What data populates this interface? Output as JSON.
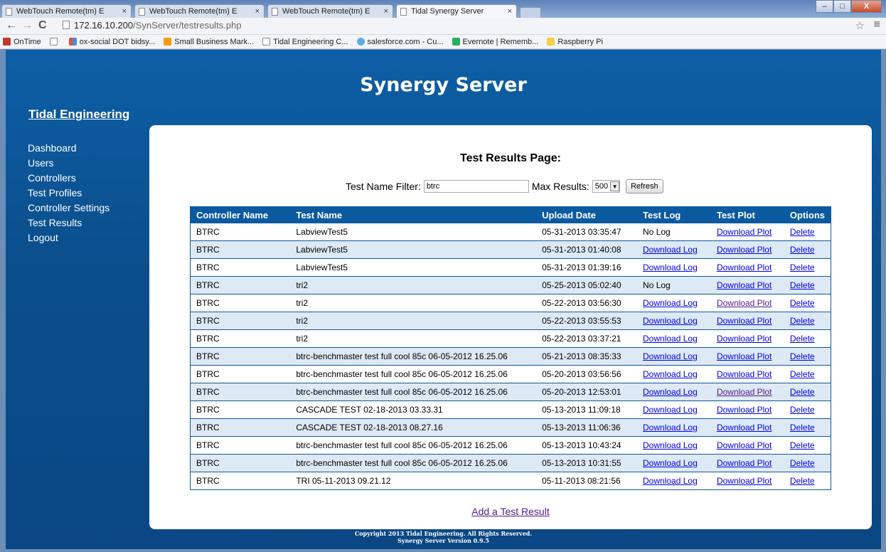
{
  "browser": {
    "tabs": [
      {
        "title": "WebTouch Remote(tm) E"
      },
      {
        "title": "WebTouch Remote(tm) E"
      },
      {
        "title": "WebTouch Remote(tm) E"
      },
      {
        "title": "Tidal Synergy Server"
      }
    ],
    "url_host": "172.16.10.200",
    "url_path": "/SynServer/testresults.php",
    "bookmarks": [
      {
        "label": "OnTime",
        "color": "#c0392b"
      },
      {
        "label": "",
        "color": "#ffffff"
      },
      {
        "label": "ox-social DOT bidsy...",
        "color": "#e74c3c"
      },
      {
        "label": "Small Business Mark...",
        "color": "#f39c12"
      },
      {
        "label": "Tidal Engineering C...",
        "color": "#ffffff"
      },
      {
        "label": "salesforce.com - Cu...",
        "color": "#5dade2"
      },
      {
        "label": "Evernote | Rememb...",
        "color": "#27ae60"
      },
      {
        "label": "Raspberry Pi",
        "color": "#f4d03f"
      }
    ]
  },
  "site": {
    "title": "Synergy Server",
    "brand": "Tidal Engineering",
    "nav": [
      "Dashboard",
      "Users",
      "Controllers",
      "Test Profiles",
      "Controller Settings",
      "Test Results",
      "Logout"
    ],
    "footer_line1": "Copyright 2013 Tidal Engineering. All Rights Reserved.",
    "footer_line2": "Synergy Server Version 0.9.5"
  },
  "content": {
    "heading": "Test Results Page:",
    "filter_label": "Test Name Filter:",
    "filter_value": "btrc",
    "max_label": "Max Results:",
    "max_value": "500",
    "refresh_label": "Refresh",
    "add_link": "Add a Test Result",
    "columns": [
      "Controller Name",
      "Test Name",
      "Upload Date",
      "Test Log",
      "Test Plot",
      "Options"
    ],
    "rows": [
      {
        "controller": "BTRC",
        "test": "LabviewTest5",
        "date": "05-31-2013 03:35:47",
        "log": "No Log",
        "plot": "Download Plot",
        "option": "Delete"
      },
      {
        "controller": "BTRC",
        "test": "LabviewTest5",
        "date": "05-31-2013 01:40:08",
        "log": "Download Log",
        "plot": "Download Plot",
        "option": "Delete"
      },
      {
        "controller": "BTRC",
        "test": "LabviewTest5",
        "date": "05-31-2013 01:39:16",
        "log": "Download Log",
        "plot": "Download Plot",
        "option": "Delete"
      },
      {
        "controller": "BTRC",
        "test": "tri2",
        "date": "05-25-2013 05:02:40",
        "log": "No Log",
        "plot": "Download Plot",
        "option": "Delete"
      },
      {
        "controller": "BTRC",
        "test": "tri2",
        "date": "05-22-2013 03:56:30",
        "log": "Download Log",
        "plot": "Download Plot",
        "option": "Delete"
      },
      {
        "controller": "BTRC",
        "test": "tri2",
        "date": "05-22-2013 03:55:53",
        "log": "Download Log",
        "plot": "Download Plot",
        "option": "Delete"
      },
      {
        "controller": "BTRC",
        "test": "tri2",
        "date": "05-22-2013 03:37:21",
        "log": "Download Log",
        "plot": "Download Plot",
        "option": "Delete"
      },
      {
        "controller": "BTRC",
        "test": "btrc-benchmaster test full cool 85c 06-05-2012 16.25.06",
        "date": "05-21-2013 08:35:33",
        "log": "Download Log",
        "plot": "Download Plot",
        "option": "Delete"
      },
      {
        "controller": "BTRC",
        "test": "btrc-benchmaster test full cool 85c 06-05-2012 16.25.06",
        "date": "05-20-2013 03:56:56",
        "log": "Download Log",
        "plot": "Download Plot",
        "option": "Delete"
      },
      {
        "controller": "BTRC",
        "test": "btrc-benchmaster test full cool 85c 06-05-2012 16.25.06",
        "date": "05-20-2013 12:53:01",
        "log": "Download Log",
        "plot": "Download Plot",
        "option": "Delete"
      },
      {
        "controller": "BTRC",
        "test": "CASCADE TEST 02-18-2013 03.33.31",
        "date": "05-13-2013 11:09:18",
        "log": "Download Log",
        "plot": "Download Plot",
        "option": "Delete"
      },
      {
        "controller": "BTRC",
        "test": "CASCADE TEST 02-18-2013 08.27.16",
        "date": "05-13-2013 11:06:36",
        "log": "Download Log",
        "plot": "Download Plot",
        "option": "Delete"
      },
      {
        "controller": "BTRC",
        "test": "btrc-benchmaster test full cool 85c 06-05-2012 16.25.06",
        "date": "05-13-2013 10:43:24",
        "log": "Download Log",
        "plot": "Download Plot",
        "option": "Delete"
      },
      {
        "controller": "BTRC",
        "test": "btrc-benchmaster test full cool 85c 06-05-2012 16.25.06",
        "date": "05-13-2013 10:31:55",
        "log": "Download Log",
        "plot": "Download Plot",
        "option": "Delete"
      },
      {
        "controller": "BTRC",
        "test": "TRI 05-11-2013 09.21.12",
        "date": "05-11-2013 08:21:56",
        "log": "Download Log",
        "plot": "Download Plot",
        "option": "Delete"
      }
    ]
  }
}
